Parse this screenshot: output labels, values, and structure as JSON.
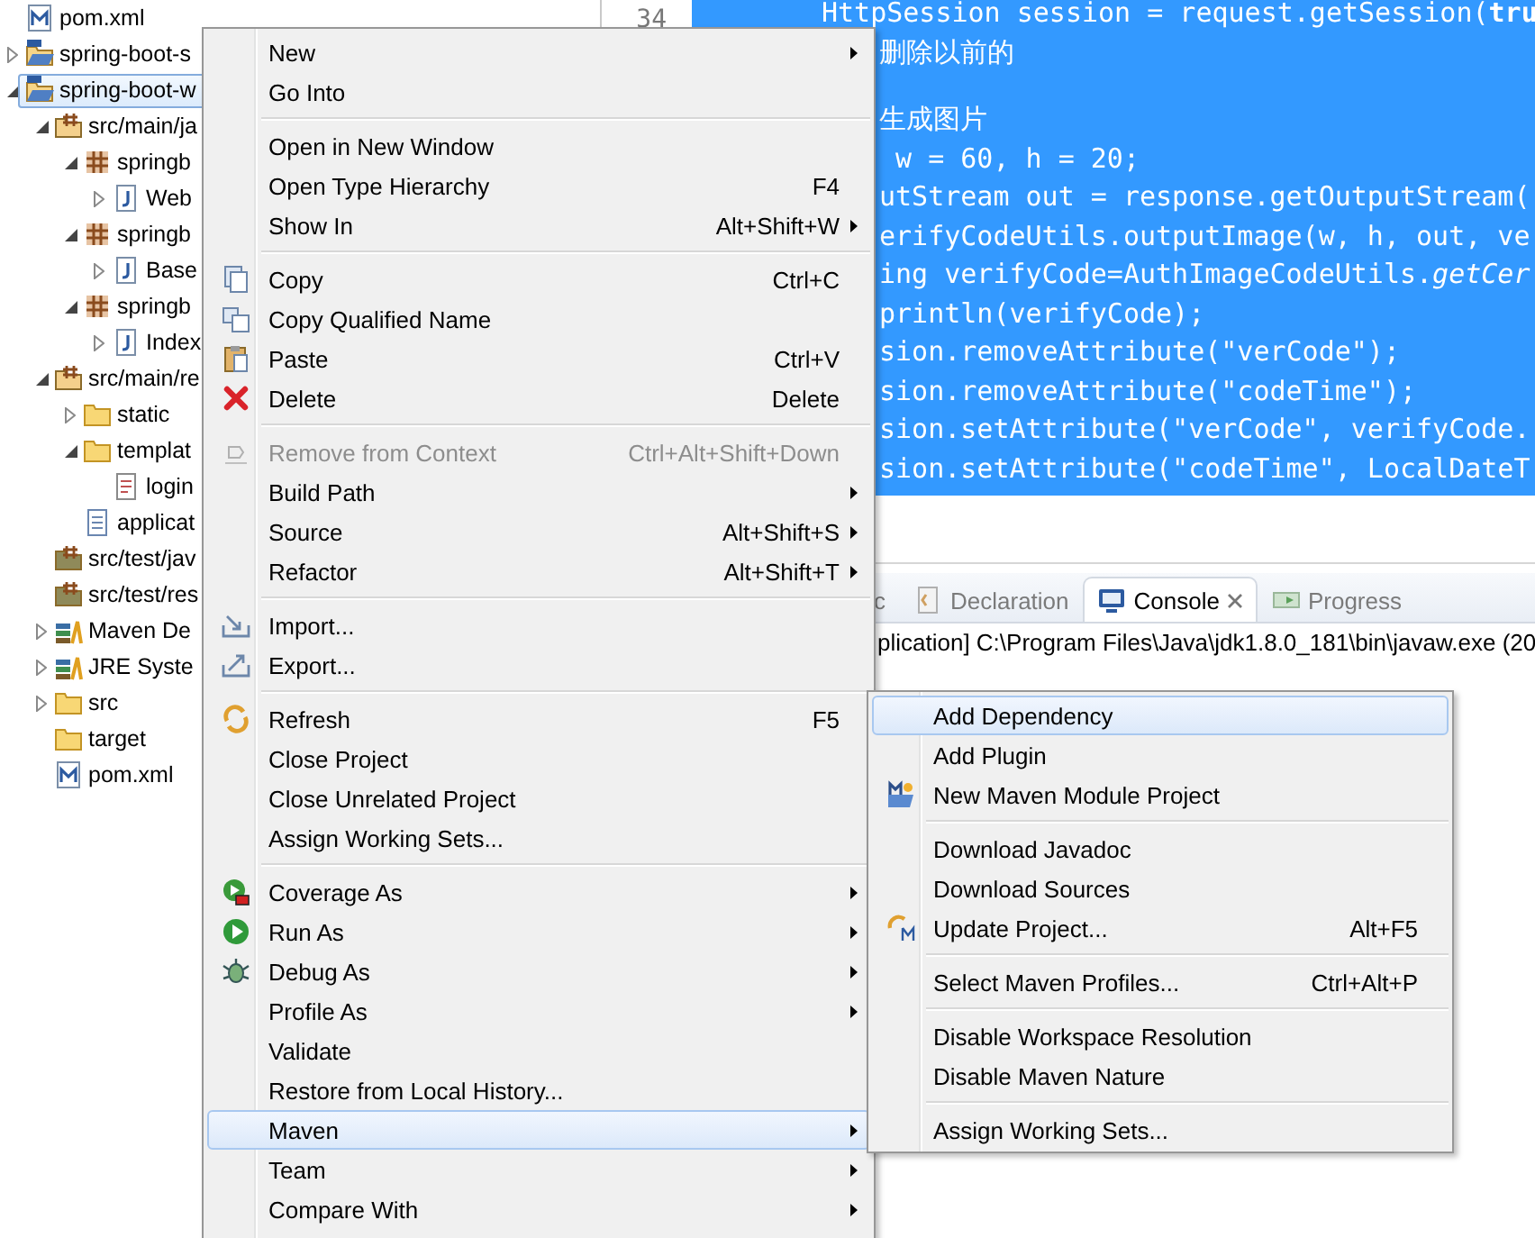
{
  "explorer": {
    "items": [
      {
        "label": "pom.xml",
        "kind": "maven-file",
        "selected": false
      },
      {
        "label": "spring-boot-s",
        "kind": "project",
        "expanded": false,
        "selected": false
      },
      {
        "label": "spring-boot-w",
        "kind": "project",
        "expanded": true,
        "selected": true,
        "children": [
          {
            "label": "src/main/ja",
            "kind": "source-folder",
            "expanded": true,
            "selected": false,
            "children": [
              {
                "label": "springb",
                "kind": "package",
                "expanded": true,
                "selected": false,
                "children": [
                  {
                    "label": "Web",
                    "kind": "java-file",
                    "expanded": false,
                    "selected": false
                  }
                ]
              },
              {
                "label": "springb",
                "kind": "package",
                "expanded": true,
                "selected": false,
                "children": [
                  {
                    "label": "Base",
                    "kind": "java-file",
                    "expanded": false,
                    "selected": false
                  }
                ]
              },
              {
                "label": "springb",
                "kind": "package",
                "expanded": true,
                "selected": false,
                "children": [
                  {
                    "label": "Index",
                    "kind": "java-file",
                    "expanded": false,
                    "selected": false
                  }
                ]
              }
            ]
          },
          {
            "label": "src/main/re",
            "kind": "source-folder",
            "expanded": true,
            "selected": false,
            "children": [
              {
                "label": "static",
                "kind": "folder",
                "expanded": false,
                "selected": false
              },
              {
                "label": "templat",
                "kind": "folder",
                "expanded": true,
                "selected": false,
                "children": [
                  {
                    "label": "login",
                    "kind": "html-file",
                    "selected": false
                  }
                ]
              },
              {
                "label": "applicat",
                "kind": "text-file",
                "selected": false
              }
            ]
          },
          {
            "label": "src/test/jav",
            "kind": "empty-source-folder",
            "selected": false
          },
          {
            "label": "src/test/res",
            "kind": "empty-source-folder",
            "selected": false
          },
          {
            "label": "Maven De",
            "kind": "library",
            "expanded": false,
            "selected": false
          },
          {
            "label": "JRE Syste",
            "kind": "library",
            "expanded": false,
            "selected": false
          },
          {
            "label": "src",
            "kind": "folder",
            "expanded": false,
            "selected": false
          },
          {
            "label": "target",
            "kind": "folder",
            "selected": false
          },
          {
            "label": "pom.xml",
            "kind": "maven-file",
            "selected": false
          }
        ]
      }
    ]
  },
  "editor": {
    "line_number": "34",
    "blocks": [
      [
        {
          "text": "HttpSession session = request.getSession(**tru**",
          "kind": "whole"
        },
        {
          "text": "删除以前的",
          "kind": "clipped"
        }
      ],
      [
        {
          "text": "生成图片",
          "kind": "clipped"
        },
        {
          "text": " w = 60, h = 20;",
          "kind": "clipped"
        },
        {
          "text": "utStream out = response.getOutputStream(",
          "kind": "clipped"
        },
        {
          "text": "erifyCodeUtils.outputImage(w, h, out, ve",
          "kind": "clipped"
        },
        {
          "text": "ing verifyCode=AuthImageCodeUtils.*getCer*",
          "kind": "clipped"
        },
        {
          "text": "println(verifyCode);",
          "kind": "clipped"
        },
        {
          "text": "sion.removeAttribute(\"verCode\");",
          "kind": "clipped"
        },
        {
          "text": "sion.removeAttribute(\"codeTime\");",
          "kind": "clipped"
        },
        {
          "text": "sion.setAttribute(\"verCode\", verifyCode.",
          "kind": "clipped"
        },
        {
          "text": "sion.setAttribute(\"codeTime\", LocalDateT",
          "kind": "clipped"
        }
      ]
    ]
  },
  "console_view": {
    "tabs": [
      {
        "label": "c",
        "kind": "javadoc",
        "selected": false
      },
      {
        "label": "Declaration",
        "kind": "declaration",
        "selected": false
      },
      {
        "label": "Console",
        "kind": "console",
        "selected": true,
        "closable": true
      },
      {
        "label": "Progress",
        "kind": "progress",
        "selected": false
      }
    ],
    "output": "plication] C:\\Program Files\\Java\\jdk1.8.0_181\\bin\\javaw.exe (20"
  },
  "context_menu": {
    "groups": [
      [
        {
          "label": "New",
          "kind": "plain",
          "submenu": true,
          "selected": false
        },
        {
          "label": "Go Into",
          "kind": "plain",
          "selected": false
        }
      ],
      [
        {
          "label": "Open in New Window",
          "kind": "plain",
          "selected": false
        },
        {
          "label": "Open Type Hierarchy",
          "kind": "plain",
          "shortcut": "F4",
          "selected": false
        },
        {
          "label": "Show In",
          "kind": "plain",
          "shortcut": "Alt+Shift+W",
          "submenu": true,
          "selected": false
        }
      ],
      [
        {
          "label": "Copy",
          "kind": "copy",
          "shortcut": "Ctrl+C",
          "selected": false
        },
        {
          "label": "Copy Qualified Name",
          "kind": "copy-name",
          "selected": false
        },
        {
          "label": "Paste",
          "kind": "paste",
          "shortcut": "Ctrl+V",
          "selected": false
        },
        {
          "label": "Delete",
          "kind": "delete",
          "shortcut": "Delete",
          "selected": false
        }
      ],
      [
        {
          "label": "Remove from Context",
          "kind": "remove",
          "shortcut": "Ctrl+Alt+Shift+Down",
          "disabled": true,
          "selected": false
        },
        {
          "label": "Build Path",
          "kind": "plain",
          "submenu": true,
          "selected": false
        },
        {
          "label": "Source",
          "kind": "plain",
          "shortcut": "Alt+Shift+S",
          "submenu": true,
          "selected": false
        },
        {
          "label": "Refactor",
          "kind": "plain",
          "shortcut": "Alt+Shift+T",
          "submenu": true,
          "selected": false
        }
      ],
      [
        {
          "label": "Import...",
          "kind": "import",
          "selected": false
        },
        {
          "label": "Export...",
          "kind": "export",
          "selected": false
        }
      ],
      [
        {
          "label": "Refresh",
          "kind": "refresh",
          "shortcut": "F5",
          "selected": false
        },
        {
          "label": "Close Project",
          "kind": "plain",
          "selected": false
        },
        {
          "label": "Close Unrelated Project",
          "kind": "plain",
          "selected": false
        },
        {
          "label": "Assign Working Sets...",
          "kind": "plain",
          "selected": false
        }
      ],
      [
        {
          "label": "Coverage As",
          "kind": "coverage",
          "submenu": true,
          "selected": false
        },
        {
          "label": "Run As",
          "kind": "run",
          "submenu": true,
          "selected": false
        },
        {
          "label": "Debug As",
          "kind": "debug",
          "submenu": true,
          "selected": false
        },
        {
          "label": "Profile As",
          "kind": "plain",
          "submenu": true,
          "selected": false
        },
        {
          "label": "Validate",
          "kind": "plain",
          "selected": false
        },
        {
          "label": "Restore from Local History...",
          "kind": "plain",
          "selected": false
        },
        {
          "label": "Maven",
          "kind": "plain",
          "submenu": true,
          "selected": true
        },
        {
          "label": "Team",
          "kind": "plain",
          "submenu": true,
          "selected": false
        },
        {
          "label": "Compare With",
          "kind": "plain",
          "submenu": true,
          "selected": false
        }
      ]
    ]
  },
  "maven_submenu": {
    "groups": [
      [
        {
          "label": "Add Dependency",
          "kind": "plain",
          "selected": true
        },
        {
          "label": "Add Plugin",
          "kind": "plain",
          "selected": false
        },
        {
          "label": "New Maven Module Project",
          "kind": "maven-module",
          "selected": false
        }
      ],
      [
        {
          "label": "Download Javadoc",
          "kind": "plain",
          "selected": false
        },
        {
          "label": "Download Sources",
          "kind": "plain",
          "selected": false
        },
        {
          "label": "Update Project...",
          "kind": "update",
          "shortcut": "Alt+F5",
          "selected": false
        }
      ],
      [
        {
          "label": "Select Maven Profiles...",
          "kind": "plain",
          "shortcut": "Ctrl+Alt+P",
          "selected": false
        }
      ],
      [
        {
          "label": "Disable Workspace Resolution",
          "kind": "plain",
          "selected": false
        },
        {
          "label": "Disable Maven Nature",
          "kind": "plain",
          "selected": false
        }
      ],
      [
        {
          "label": "Assign Working Sets...",
          "kind": "plain",
          "selected": false
        }
      ]
    ]
  }
}
